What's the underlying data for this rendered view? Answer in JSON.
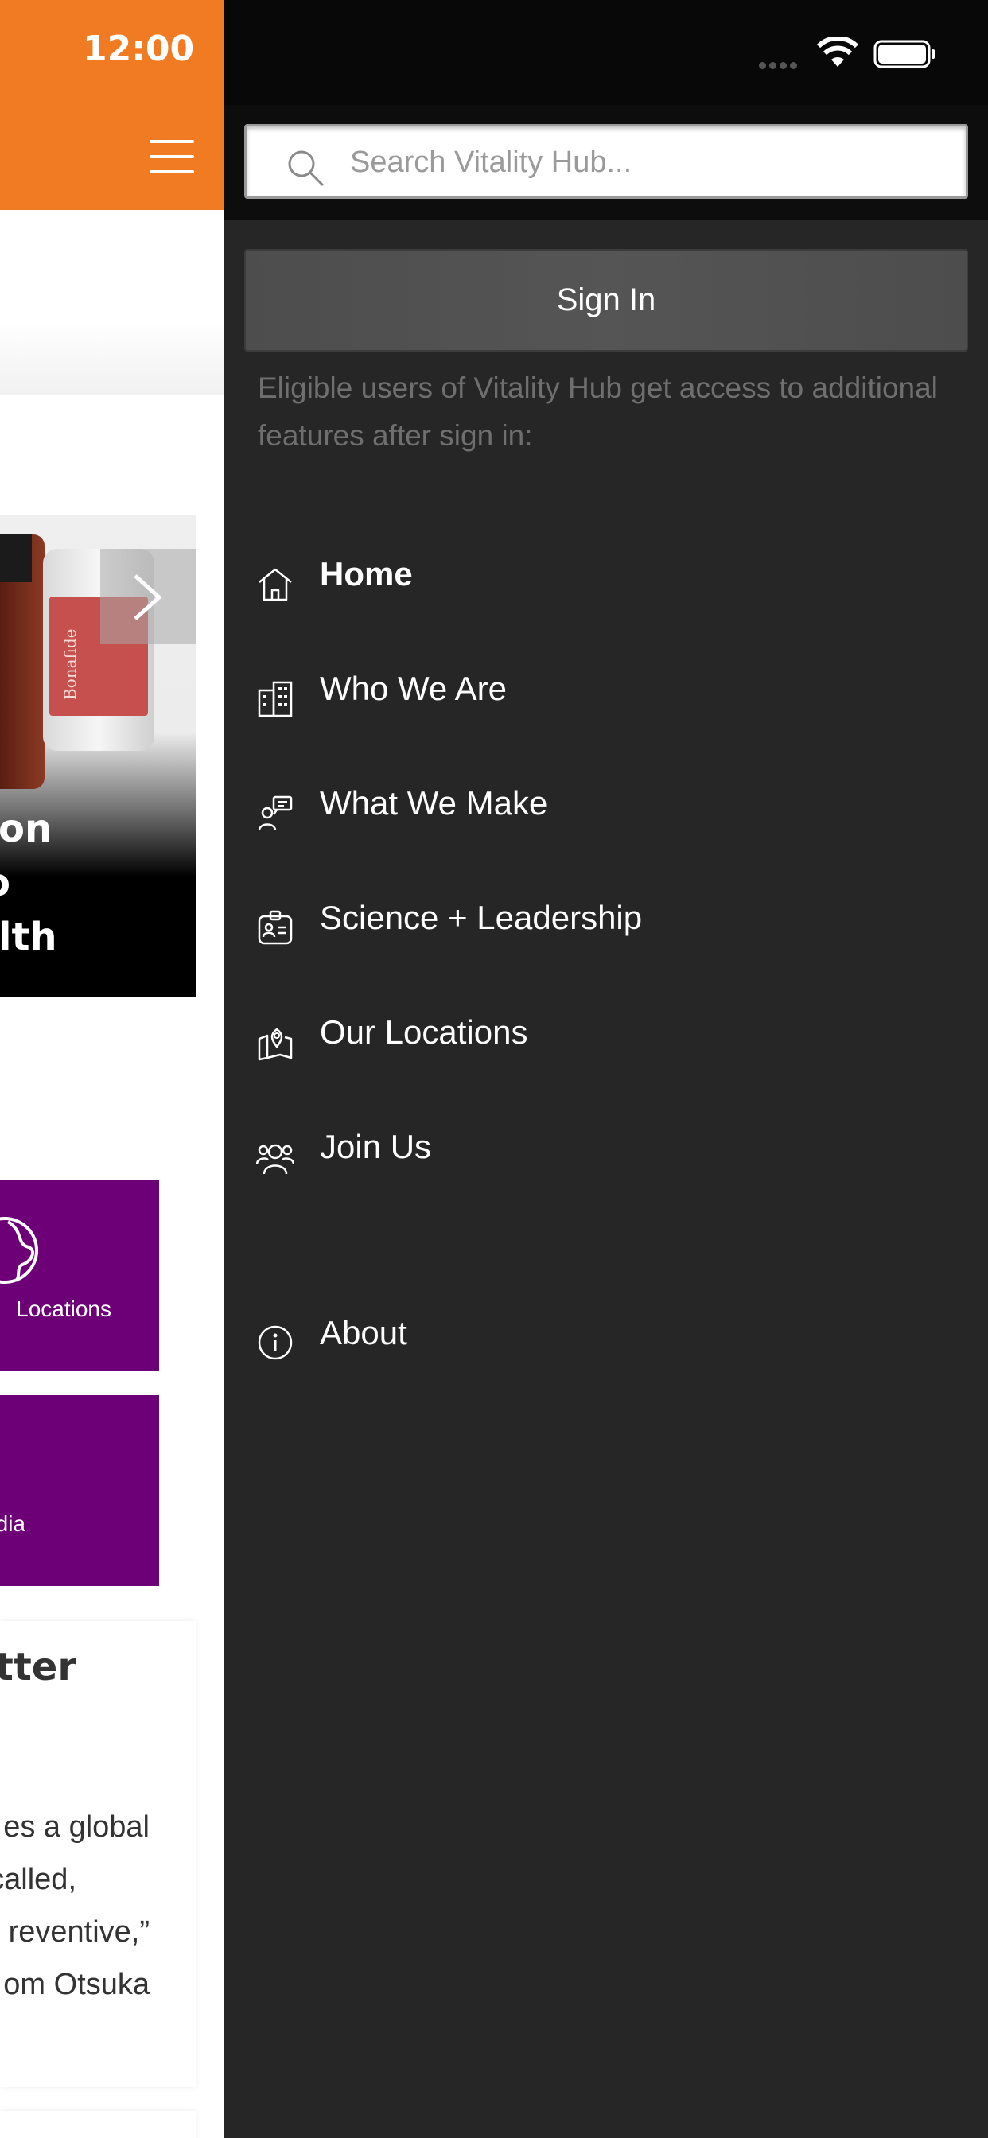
{
  "status_bar": {
    "time": "12:00"
  },
  "background_page": {
    "carousel_lines": [
      "on",
      "o",
      "lth"
    ],
    "bottle_label": "Bonafide",
    "tiles": [
      {
        "label": "Locations"
      },
      {
        "label": "dia"
      }
    ],
    "news": {
      "title": "tter",
      "lines": [
        "es a global",
        "called,",
        "reventive,”",
        "om Otsuka"
      ]
    }
  },
  "drawer": {
    "search": {
      "placeholder": "Search Vitality Hub..."
    },
    "sign_in_label": "Sign In",
    "sign_in_note": "Eligible users of Vitality Hub get access to additional features after sign in:",
    "nav": [
      {
        "label": "Home",
        "icon": "home-icon",
        "active": true
      },
      {
        "label": "Who We Are",
        "icon": "building-icon"
      },
      {
        "label": "What We Make",
        "icon": "presenter-icon"
      },
      {
        "label": "Science + Leadership",
        "icon": "id-badge-icon"
      },
      {
        "label": "Our Locations",
        "icon": "map-pin-icon"
      },
      {
        "label": "Join Us",
        "icon": "team-icon"
      },
      {
        "label": "About",
        "icon": "info-icon"
      }
    ]
  }
}
